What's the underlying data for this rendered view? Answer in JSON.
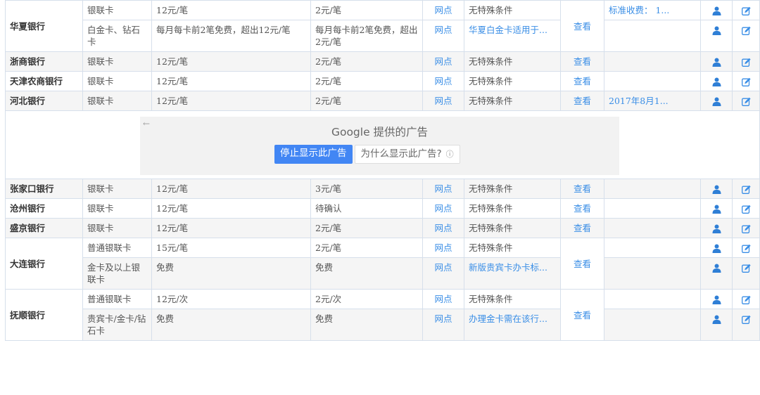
{
  "icons": {
    "user": "user-icon",
    "edit": "edit-icon"
  },
  "colors": {
    "link": "#3a8ee6",
    "stop_button": "#4286f4",
    "ad_bg": "#f2f2f2",
    "alt_row": "#f5f5f5"
  },
  "rows": [
    {
      "bank": "华夏银行",
      "card": "银联卡",
      "fee": "12元/笔",
      "local": "2元/笔",
      "net": "网点",
      "cond": "无特殊条件",
      "view": "查看",
      "note": "标准收费： 1..."
    },
    {
      "card": "白金卡、钻石卡",
      "fee": "每月每卡前2笔免费，超出12元/笔",
      "local": "每月每卡前2笔免费，超出2元/笔",
      "net": "网点",
      "cond": "华夏白金卡适用于...",
      "note": ""
    },
    {
      "bank": "浙商银行",
      "card": "银联卡",
      "fee": "12元/笔",
      "local": "2元/笔",
      "net": "网点",
      "cond": "无特殊条件",
      "view": "查看",
      "note": ""
    },
    {
      "bank": "天津农商银行",
      "card": "银联卡",
      "fee": "12元/笔",
      "local": "2元/笔",
      "net": "网点",
      "cond": "无特殊条件",
      "view": "查看",
      "note": ""
    },
    {
      "bank": "河北银行",
      "card": "银联卡",
      "fee": "12元/笔",
      "local": "2元/笔",
      "net": "网点",
      "cond": "无特殊条件",
      "view": "查看",
      "note": "2017年8月1..."
    },
    {
      "bank": "张家口银行",
      "card": "银联卡",
      "fee": "12元/笔",
      "local": "3元/笔",
      "net": "网点",
      "cond": "无特殊条件",
      "view": "查看",
      "note": ""
    },
    {
      "bank": "沧州银行",
      "card": "银联卡",
      "fee": "12元/笔",
      "local": "待确认",
      "net": "网点",
      "cond": "无特殊条件",
      "view": "查看",
      "note": ""
    },
    {
      "bank": "盛京银行",
      "card": "银联卡",
      "fee": "12元/笔",
      "local": "2元/笔",
      "net": "网点",
      "cond": "无特殊条件",
      "view": "查看",
      "note": ""
    },
    {
      "bank": "大连银行",
      "card": "普通银联卡",
      "fee": "15元/笔",
      "local": "2元/笔",
      "net": "网点",
      "cond": "无特殊条件",
      "view": "查看",
      "note": ""
    },
    {
      "card": "金卡及以上银联卡",
      "fee": "免费",
      "local": "免费",
      "net": "网点",
      "cond": "新版贵宾卡办卡标...",
      "note": ""
    },
    {
      "bank": "抚顺银行",
      "card": "普通银联卡",
      "fee": "12元/次",
      "local": "2元/次",
      "net": "网点",
      "cond": "无特殊条件",
      "view": "查看",
      "note": ""
    },
    {
      "card": "贵宾卡/金卡/钻石卡",
      "fee": "免费",
      "local": "免费",
      "net": "网点",
      "cond": "办理金卡需在该行...",
      "note": ""
    }
  ],
  "ad": {
    "back_arrow": "←",
    "title": "Google 提供的广告",
    "stop_label": "停止显示此广告",
    "why_label": "为什么显示此广告?",
    "info_glyph": "ⓘ"
  }
}
